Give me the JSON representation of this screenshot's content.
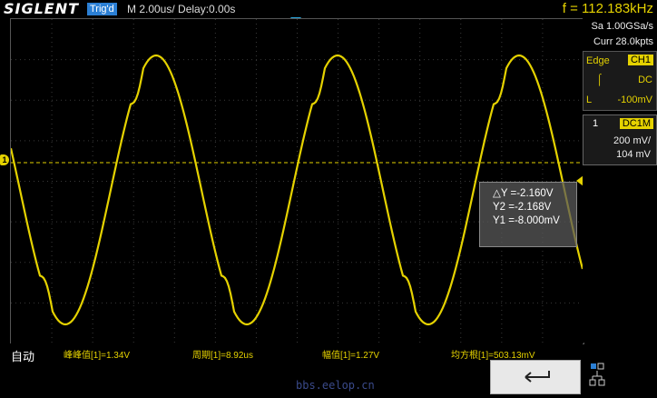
{
  "header": {
    "brand": "SIGLENT",
    "trig_status": "Trig'd",
    "timebase": "M 2.00us/  Delay:0.00s",
    "frequency": "f = 112.183kHz"
  },
  "acquisition": {
    "sample_rate": "Sa 1.00GSa/s",
    "memory": "Curr 28.0kpts"
  },
  "trigger": {
    "type": "Edge",
    "source": "CH1",
    "slope_icon": "rising-edge-icon",
    "coupling": "DC",
    "level_label": "L",
    "level": "-100mV"
  },
  "channel": {
    "number": "1",
    "coupling": "DC1M",
    "scale": "200 mV/",
    "offset": "104 mV"
  },
  "cursor": {
    "delta_y": "△Y =-2.160V",
    "y2": "Y2 =-2.168V",
    "y1": "Y1 =-8.000mV"
  },
  "measurements": {
    "mode": "自动",
    "pk_pk": "峰峰值[1]=1.34V",
    "period": "周期[1]=8.92us",
    "amplitude": "幅值[1]=1.27V",
    "rms": "均方根[1]=503.13mV"
  },
  "ground_marker": "1",
  "watermark": "bbs.eelop.cn",
  "colors": {
    "trace": "#e5d200",
    "trig_badge": "#2b7fd4",
    "grid": "#3a3a3a"
  }
}
